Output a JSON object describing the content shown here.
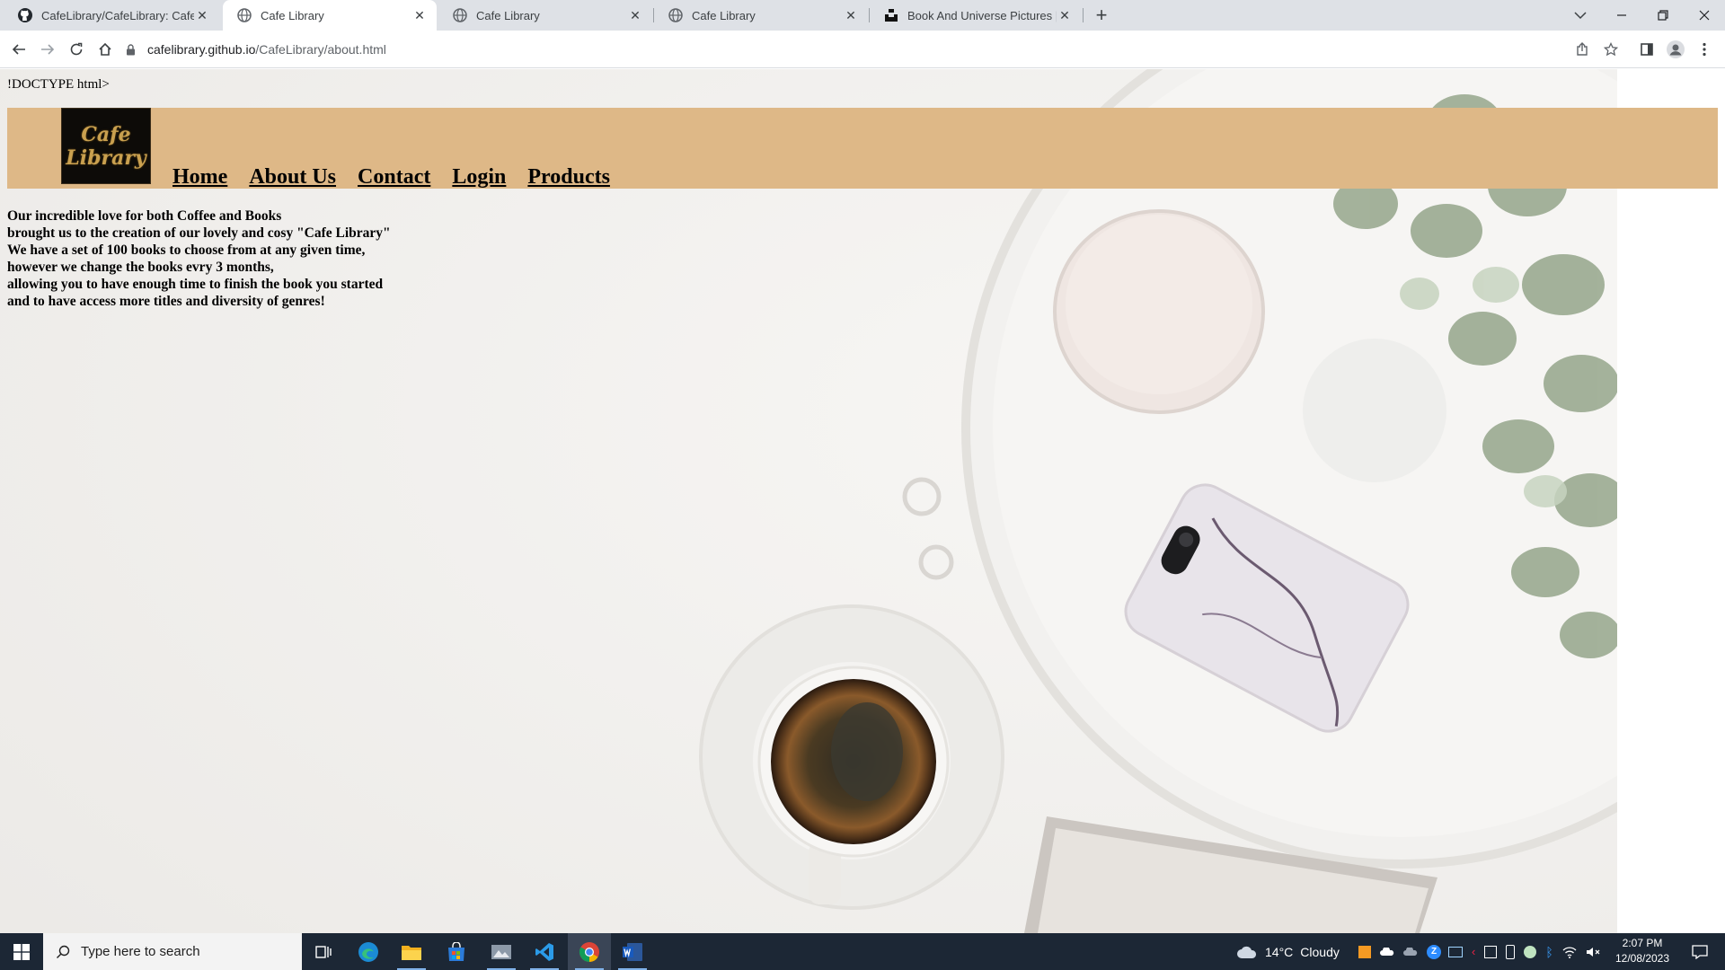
{
  "browser": {
    "tabs": [
      {
        "title": "CafeLibrary/CafeLibrary: Cafe Libr",
        "icon": "github-icon",
        "active": false
      },
      {
        "title": "Cafe Library",
        "icon": "globe-icon",
        "active": true
      },
      {
        "title": "Cafe Library",
        "icon": "globe-icon",
        "active": false
      },
      {
        "title": "Cafe Library",
        "icon": "globe-icon",
        "active": false
      },
      {
        "title": "Book And Universe Pictures | Dow",
        "icon": "unsplash-icon",
        "active": false
      }
    ],
    "new_tab_symbol": "+",
    "url_host": "cafelibrary.github.io",
    "url_path": "/CafeLibrary/about.html"
  },
  "page": {
    "doctype_text": "!DOCTYPE html>",
    "logo": {
      "line1": "Cafe",
      "line2": "Library"
    },
    "nav": [
      "Home",
      "About Us",
      "Contact",
      "Login",
      "Products"
    ],
    "about_lines": [
      "Our incredible love for both Coffee and Books",
      "brought us to the creation of our lovely and cosy \"Cafe Library\"",
      "We have a set of 100 books to choose from at any given time,",
      "however we change the books evry 3 months,",
      "allowing you to have enough time to finish the book you started",
      "and to have access more titles and diversity of genres!"
    ],
    "colors": {
      "header_bg": "#deb887",
      "logo_text": "#c9a04f"
    }
  },
  "taskbar": {
    "search_placeholder": "Type here to search",
    "weather_temp": "14°C",
    "weather_desc": "Cloudy",
    "time": "2:07 PM",
    "date": "12/08/2023",
    "apps": [
      "task-view-icon",
      "edge-icon",
      "file-explorer-icon",
      "store-icon",
      "photos-icon",
      "vscode-icon",
      "chrome-icon",
      "word-icon"
    ]
  }
}
